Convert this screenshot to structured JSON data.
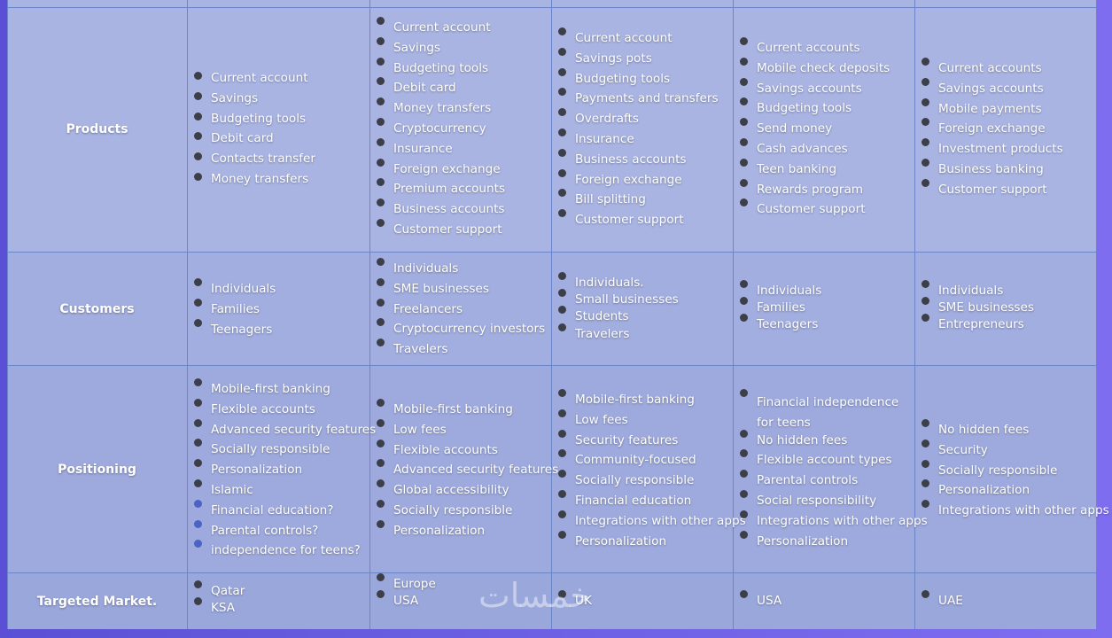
{
  "rows": [
    {
      "header": "Products",
      "columns": [
        [
          "Current account",
          "Savings",
          "Budgeting tools",
          "Debit card",
          "Contacts transfer",
          "Money transfers"
        ],
        [
          "Current account",
          "Savings",
          "Budgeting tools",
          "Debit card",
          "Money transfers",
          "Cryptocurrency",
          "Insurance",
          "Foreign exchange",
          "Premium accounts",
          "Business accounts",
          "Customer support"
        ],
        [
          "Current account",
          "Savings pots",
          "Budgeting tools",
          "Payments and transfers",
          "Overdrafts",
          "Insurance",
          "Business accounts",
          "Foreign exchange",
          "Bill splitting",
          "Customer support"
        ],
        [
          "Current accounts",
          "Mobile check deposits",
          "Savings accounts",
          "Budgeting tools",
          "Send money",
          "Cash advances",
          "Teen banking",
          "Rewards program",
          "Customer support"
        ],
        [
          "Current accounts",
          "Savings accounts",
          "Mobile payments",
          "Foreign exchange",
          "Investment products",
          "Business banking",
          "Customer support"
        ]
      ]
    },
    {
      "header": "Customers",
      "columns": [
        [
          "Individuals",
          "Families",
          "Teenagers"
        ],
        [
          "Individuals",
          "SME businesses",
          "Freelancers",
          "Cryptocurrency investors",
          "Travelers"
        ],
        [
          "Individuals.",
          "Small businesses",
          "Students",
          "Travelers"
        ],
        [
          "Individuals",
          "Families",
          "Teenagers"
        ],
        [
          "Individuals",
          "SME businesses",
          "Entrepreneurs"
        ]
      ]
    },
    {
      "header": "Positioning",
      "columns": [
        [
          "Mobile-first banking",
          "Flexible accounts",
          "Advanced security features",
          "Socially responsible",
          "Personalization",
          "Islamic",
          "Financial education?",
          "Parental controls?",
          "independence for teens?"
        ],
        [
          "Mobile-first banking",
          "Low fees",
          "Flexible accounts",
          "Advanced security features",
          "Global accessibility",
          "Socially responsible",
          "Personalization"
        ],
        [
          "Mobile-first banking",
          "Low fees",
          "Security features",
          "Community-focused",
          "Socially responsible",
          "Financial education",
          "Integrations with other apps",
          "Personalization"
        ],
        [
          "Financial independence for teens",
          "No hidden fees",
          "Flexible account types",
          "Parental controls",
          "Social responsibility",
          "Integrations with other apps",
          "Personalization"
        ],
        [
          "No hidden fees",
          "Security",
          "Socially responsible",
          "Personalization",
          "Integrations with other apps"
        ]
      ]
    },
    {
      "header": "Targeted Market.",
      "columns": [
        [
          "Qatar",
          "KSA"
        ],
        [
          "Europe",
          "USA"
        ],
        [
          "UK"
        ],
        [
          "USA"
        ],
        [
          "UAE"
        ]
      ]
    }
  ],
  "watermark": "خمسات"
}
